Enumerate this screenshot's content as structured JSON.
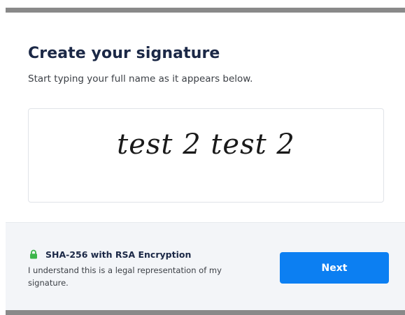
{
  "modal": {
    "title": "Create your signature",
    "subtitle": "Start typing your full name as it appears below."
  },
  "signature": {
    "typed_name": "test 2 test 2"
  },
  "footer": {
    "icon": "lock-icon",
    "encryption_label": "SHA-256 with RSA Encryption",
    "legal_text": "I understand this is a legal representation of my signature.",
    "next_label": "Next"
  },
  "colors": {
    "primary_button": "#0c7ff2",
    "heading": "#1b2846",
    "lock_icon": "#3cb54a",
    "footer_background": "#f3f5f8"
  }
}
